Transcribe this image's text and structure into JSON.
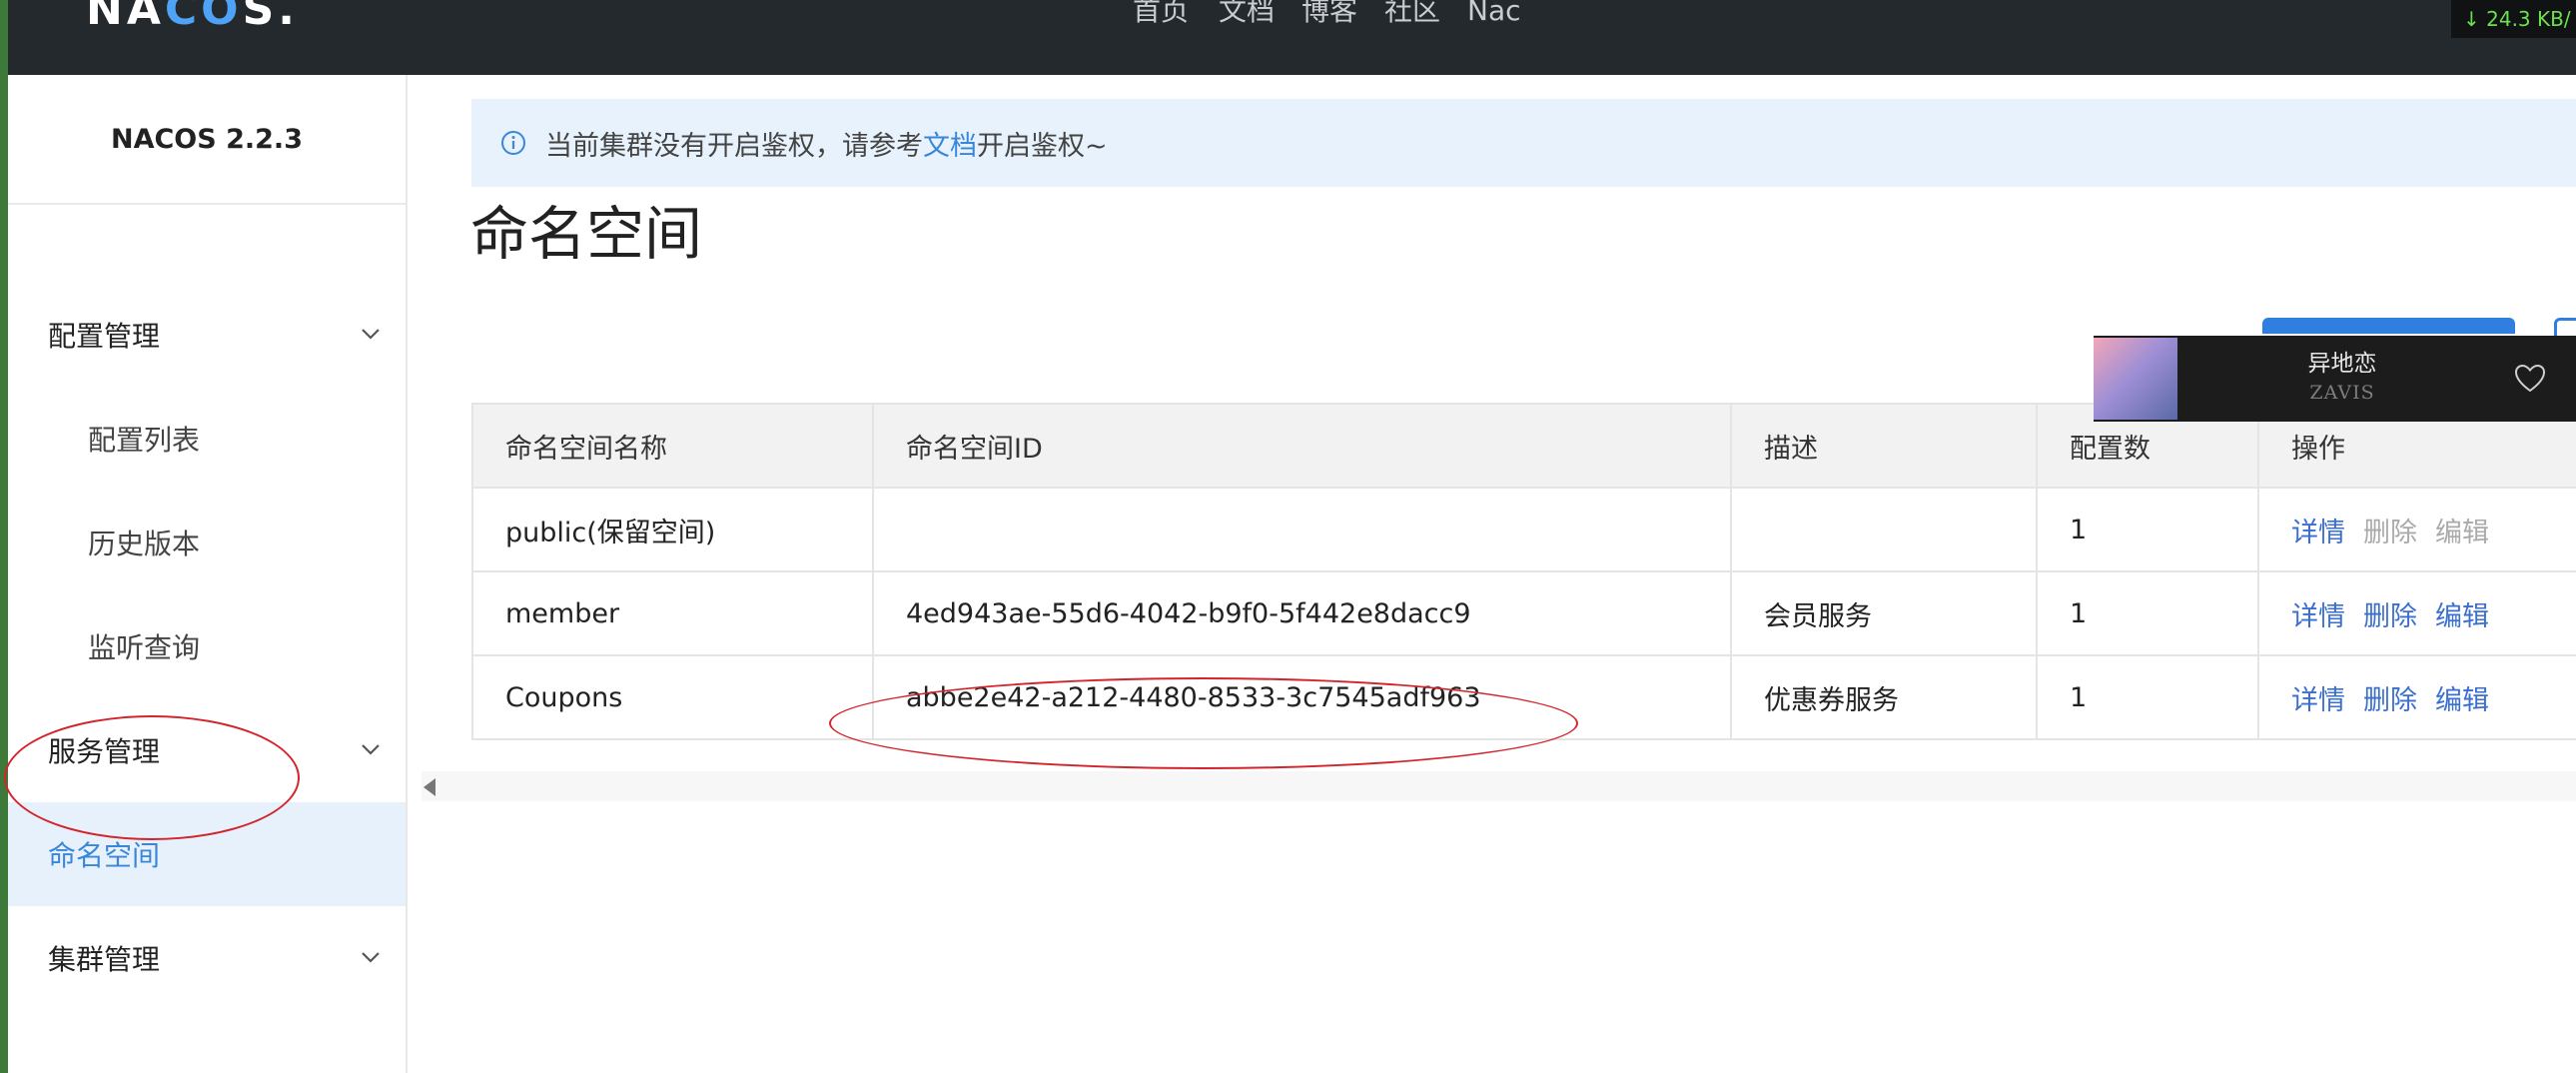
{
  "topbar": {
    "logo": {
      "prefix": "NA",
      "accent": "CO",
      "suffix": "S."
    },
    "nav": [
      "首页",
      "文档",
      "博客",
      "社区",
      "Nac"
    ],
    "speed": "↓ 24.3 KB/"
  },
  "sidebar": {
    "version": "NACOS 2.2.3",
    "items": [
      {
        "label": "配置管理",
        "level": 1,
        "expandable": true
      },
      {
        "label": "配置列表",
        "level": 2
      },
      {
        "label": "历史版本",
        "level": 2
      },
      {
        "label": "监听查询",
        "level": 2
      },
      {
        "label": "服务管理",
        "level": 1,
        "expandable": true
      },
      {
        "label": "命名空间",
        "level": 1,
        "active": true
      },
      {
        "label": "集群管理",
        "level": 1,
        "expandable": true
      }
    ]
  },
  "alert": {
    "text_before": "当前集群没有开启鉴权，请参考",
    "link": "文档",
    "text_after": "开启鉴权~"
  },
  "page": {
    "title": "命名空间"
  },
  "table": {
    "headers": [
      "命名空间名称",
      "命名空间ID",
      "描述",
      "配置数",
      "操作"
    ],
    "rows": [
      {
        "name": "public(保留空间)",
        "id": "",
        "desc": "",
        "count": "1",
        "actions": [
          "详情",
          "删除",
          "编辑"
        ],
        "disabled": [
          false,
          true,
          true
        ]
      },
      {
        "name": "member",
        "id": "4ed943ae-55d6-4042-b9f0-5f442e8dacc9",
        "desc": "会员服务",
        "count": "1",
        "actions": [
          "详情",
          "删除",
          "编辑"
        ],
        "disabled": [
          false,
          false,
          false
        ]
      },
      {
        "name": "Coupons",
        "id": "abbe2e42-a212-4480-8533-3c7545adf963",
        "desc": "优惠券服务",
        "count": "1",
        "actions": [
          "详情",
          "删除",
          "编辑"
        ],
        "disabled": [
          false,
          false,
          false
        ]
      }
    ]
  },
  "player": {
    "song": "异地恋",
    "artist": "ZAVIS"
  },
  "colors": {
    "topbar": "#24292e",
    "accent": "#3a86d8",
    "link": "#3a6fd0",
    "annotation": "#d4242b",
    "alert_bg": "#e7f2fc",
    "active_menu_bg": "#e6f1fb"
  }
}
